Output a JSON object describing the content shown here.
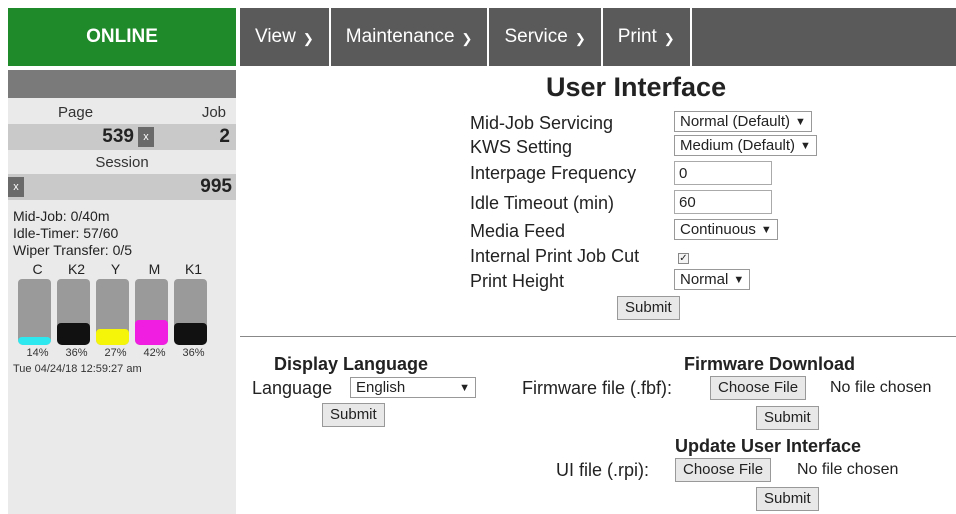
{
  "status": {
    "label": "ONLINE",
    "color": "#1f8a2a"
  },
  "nav": {
    "items": [
      {
        "label": "View"
      },
      {
        "label": "Maintenance"
      },
      {
        "label": "Service"
      },
      {
        "label": "Print"
      }
    ],
    "chevron_icon": "chevron-down-icon"
  },
  "sidebar": {
    "page_label": "Page",
    "job_label": "Job",
    "page_value": "539",
    "job_value": "2",
    "clear_label": "x",
    "session_label": "Session",
    "session_value": "995",
    "mid_job": "Mid-Job: 0/40m",
    "idle_timer": "Idle-Timer: 57/60",
    "wiper_transfer": "Wiper Transfer: 0/5",
    "inks": [
      {
        "name": "C",
        "pct_label": "14%",
        "level": 0.14,
        "color": "#2ee8f0"
      },
      {
        "name": "K2",
        "pct_label": "36%",
        "level": 0.36,
        "color": "#111111"
      },
      {
        "name": "Y",
        "pct_label": "27%",
        "level": 0.27,
        "color": "#f5f50a"
      },
      {
        "name": "M",
        "pct_label": "42%",
        "level": 0.42,
        "color": "#f01ee0"
      },
      {
        "name": "K1",
        "pct_label": "36%",
        "level": 0.36,
        "color": "#111111"
      }
    ],
    "datetime": "Tue 04/24/18 12:59:27 am"
  },
  "ui": {
    "title": "User Interface",
    "mid_job_label": "Mid-Job Servicing",
    "mid_job_value": "Normal (Default)",
    "kws_label": "KWS Setting",
    "kws_value": "Medium (Default)",
    "interpage_label": "Interpage Frequency",
    "interpage_value": "0",
    "idle_label": "Idle Timeout (min)",
    "idle_value": "60",
    "media_label": "Media Feed",
    "media_value": "Continuous",
    "cut_label": "Internal Print Job Cut",
    "cut_checked": true,
    "height_label": "Print Height",
    "height_value": "Normal",
    "submit": "Submit"
  },
  "language": {
    "title": "Display Language",
    "label": "Language",
    "value": "English",
    "submit": "Submit"
  },
  "firmware": {
    "title": "Firmware Download",
    "label": "Firmware file (.fbf):",
    "choose": "Choose File",
    "no_file": "No file chosen",
    "submit": "Submit"
  },
  "update_ui": {
    "title": "Update User Interface",
    "label": "UI file (.rpi):",
    "choose": "Choose File",
    "no_file": "No file chosen",
    "submit": "Submit"
  }
}
